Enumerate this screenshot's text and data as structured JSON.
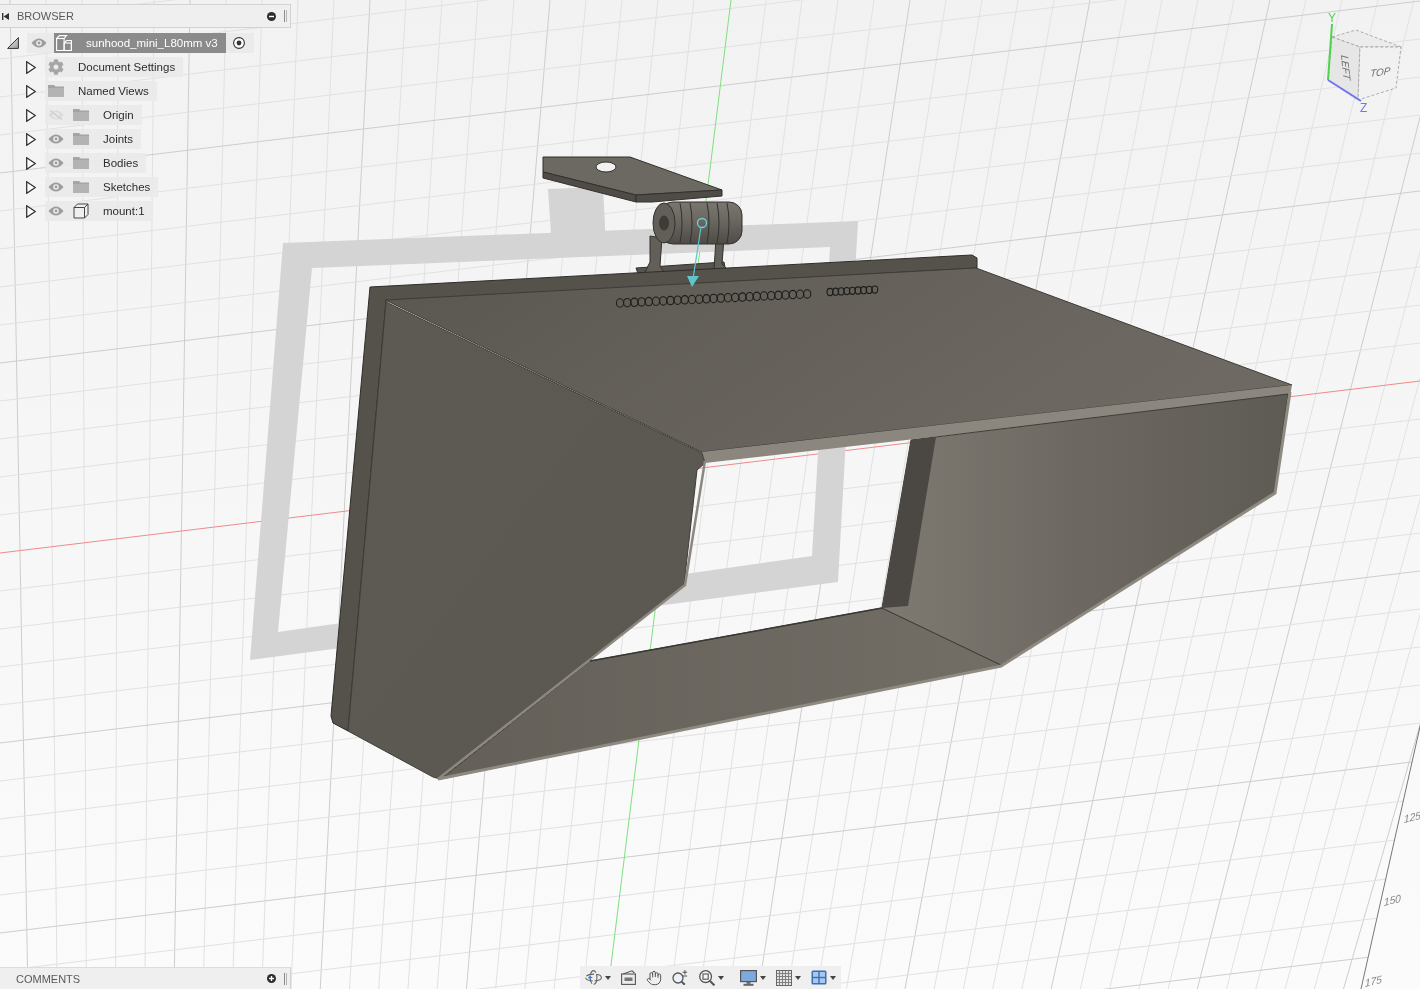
{
  "browser": {
    "title": "BROWSER",
    "root": {
      "label": "sunhood_mini_L80mm v3",
      "expanded": true,
      "visible": true,
      "active": true,
      "children": [
        {
          "kind": "settings",
          "label": "Document Settings",
          "expanded": false
        },
        {
          "kind": "folder",
          "label": "Named Views",
          "expanded": false
        },
        {
          "kind": "folder",
          "label": "Origin",
          "expanded": false,
          "visible": false
        },
        {
          "kind": "folder",
          "label": "Joints",
          "expanded": false,
          "visible": true
        },
        {
          "kind": "folder",
          "label": "Bodies",
          "expanded": false,
          "visible": true
        },
        {
          "kind": "folder",
          "label": "Sketches",
          "expanded": false,
          "visible": true
        },
        {
          "kind": "component",
          "label": "mount:1",
          "expanded": false,
          "visible": true
        }
      ]
    }
  },
  "viewcube": {
    "faces": [
      {
        "label": "LEFT"
      },
      {
        "label": "TOP"
      }
    ],
    "axes": [
      {
        "label": "Y",
        "color": "#4fd34f"
      },
      {
        "label": "Z",
        "color": "#7474f0"
      }
    ]
  },
  "grid_ruler": {
    "labels": [
      "125",
      "150",
      "175"
    ]
  },
  "comments": {
    "title": "COMMENTS"
  },
  "navigation_toolbar": {
    "groups": [
      {
        "tools": [
          {
            "kind": "orbit",
            "dropdown": true
          },
          {
            "kind": "look_at",
            "dropdown": false
          },
          {
            "kind": "pan",
            "dropdown": false
          },
          {
            "kind": "zoom",
            "dropdown": false
          },
          {
            "kind": "fit",
            "dropdown": true
          }
        ]
      },
      {
        "tools": [
          {
            "kind": "display",
            "dropdown": true
          },
          {
            "kind": "grid",
            "dropdown": true
          },
          {
            "kind": "viewports",
            "dropdown": true
          }
        ]
      }
    ]
  }
}
